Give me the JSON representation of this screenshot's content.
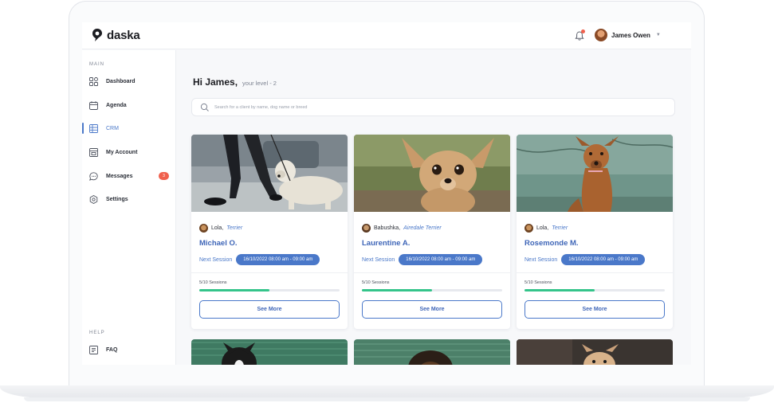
{
  "app": {
    "brand": "daska"
  },
  "topbar": {
    "user_name": "James Owen"
  },
  "sidebar": {
    "main_label": "MAIN",
    "help_label": "HELP",
    "items": [
      {
        "label": "Dashboard",
        "icon": "dashboard-icon"
      },
      {
        "label": "Agenda",
        "icon": "calendar-icon"
      },
      {
        "label": "CRM",
        "icon": "table-icon",
        "active": true
      },
      {
        "label": "My Account",
        "icon": "account-icon"
      },
      {
        "label": "Messages",
        "icon": "message-icon",
        "badge": "3"
      },
      {
        "label": "Settings",
        "icon": "gear-icon"
      }
    ],
    "help_items": [
      {
        "label": "FAQ",
        "icon": "faq-icon"
      }
    ]
  },
  "main": {
    "greeting": "Hi James,",
    "level": "your level - 2",
    "search_placeholder": "Search for a client by name, dog name or breed"
  },
  "cards": [
    {
      "dog": "Lola,",
      "breed": "Terrier",
      "client": "Michael O.",
      "session_label": "Next Session",
      "session_time": "16/10/2022 08:00 am - 09:00 am",
      "sessions": "5/10 Sessions",
      "progress": 0.5,
      "button": "See More"
    },
    {
      "dog": "Babushka,",
      "breed": "Airedale Terrier",
      "client": "Laurentine A.",
      "session_label": "Next Session",
      "session_time": "16/10/2022 08:00 am - 09:00 am",
      "sessions": "5/10 Sessions",
      "progress": 0.5,
      "button": "See More"
    },
    {
      "dog": "Lola,",
      "breed": "Terrier",
      "client": "Rosemonde M.",
      "session_label": "Next Session",
      "session_time": "16/10/2022 08:00 am - 09:00 am",
      "sessions": "5/10 Sessions",
      "progress": 0.5,
      "button": "See More"
    }
  ],
  "colors": {
    "accent": "#4a78c9",
    "progress": "#34c48a",
    "badge": "#f0604d"
  }
}
